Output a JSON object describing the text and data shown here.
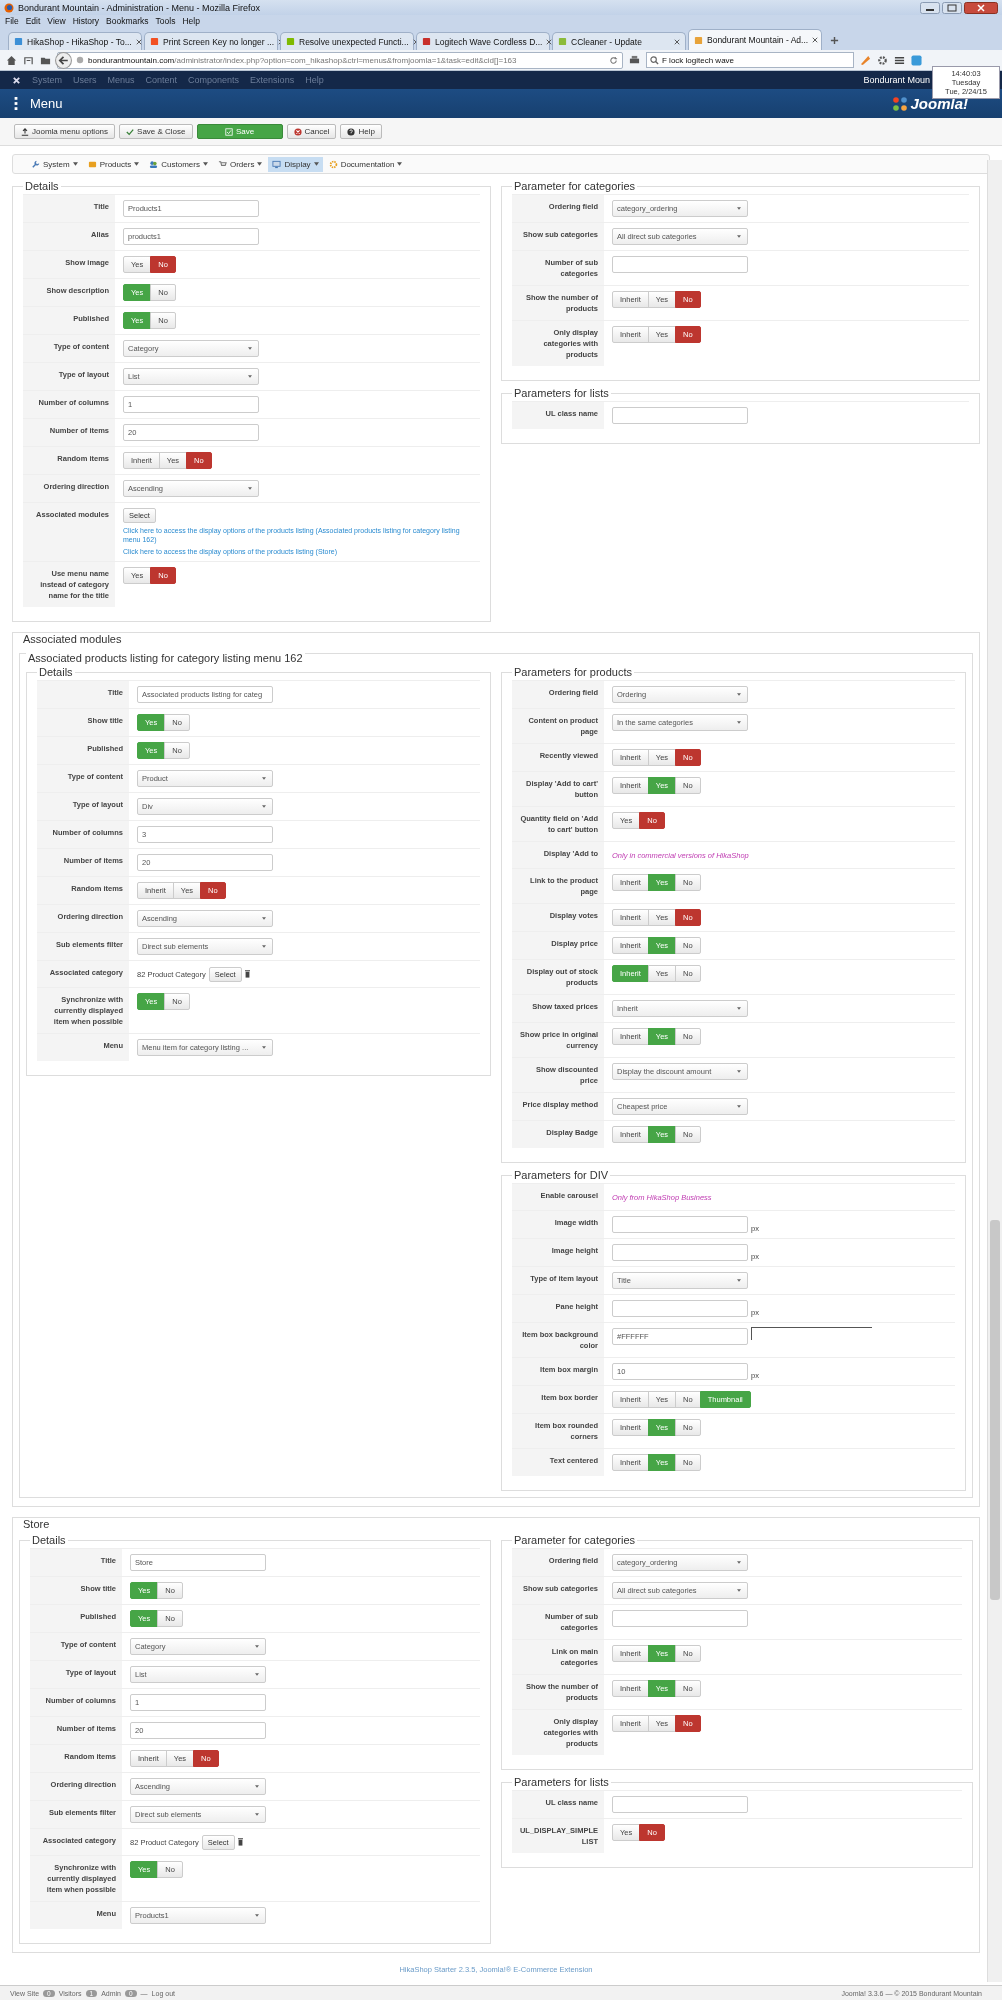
{
  "browser": {
    "title": "Bondurant Mountain - Administration - Menu - Mozilla Firefox",
    "menu": [
      "File",
      "Edit",
      "View",
      "History",
      "Bookmarks",
      "Tools",
      "Help"
    ],
    "tabs": [
      {
        "label": "HikaShop - HikaShop - To...",
        "selected": false
      },
      {
        "label": "Print Screen Key no longer ...",
        "selected": false
      },
      {
        "label": "Resolve unexpected Functi...",
        "selected": false
      },
      {
        "label": "Logitech Wave Cordless D...",
        "selected": false
      },
      {
        "label": "CCleaner - Update",
        "selected": false
      },
      {
        "label": "Bondurant Mountain - Ad...",
        "selected": true
      }
    ],
    "address": {
      "host": "bondurantmountain.com",
      "path": "/administrator/index.php?option=com_hikashop&ctrl=menus&fromjoomla=1&task=edit&cid[]=163"
    },
    "search": {
      "value": "F lock logitech wave"
    },
    "clock": [
      "14:40:03",
      "Tuesday",
      "Tue, 2/24/15"
    ]
  },
  "admin_menu": {
    "items": [
      "System",
      "Users",
      "Menus",
      "Content",
      "Components",
      "Extensions",
      "Help"
    ],
    "user": "Bondurant Moun"
  },
  "header": {
    "title": "Menu",
    "logo": "Joomla!"
  },
  "toolbar": [
    {
      "label": "Joomla menu options",
      "kind": "options"
    },
    {
      "label": "Save & Close",
      "kind": "check"
    },
    {
      "label": "Save",
      "kind": "save"
    },
    {
      "label": "Cancel",
      "kind": "cancel"
    },
    {
      "label": "Help",
      "kind": "help"
    }
  ],
  "submenu": [
    {
      "label": "System",
      "kind": "system",
      "selected": false
    },
    {
      "label": "Products",
      "kind": "products",
      "selected": false
    },
    {
      "label": "Customers",
      "kind": "customers",
      "selected": false
    },
    {
      "label": "Orders",
      "kind": "orders",
      "selected": false
    },
    {
      "label": "Display",
      "kind": "display",
      "selected": true
    },
    {
      "label": "Documentation",
      "kind": "documentation",
      "selected": false
    }
  ],
  "sections": [
    {
      "columns": [
        [
          {
            "legend": "Details",
            "rows": [
              {
                "label": "Title",
                "kind": "text",
                "value": "Products1"
              },
              {
                "label": "Alias",
                "kind": "text",
                "value": "products1"
              },
              {
                "label": "Show image",
                "kind": "toggle",
                "options": [
                  {
                    "label": "Yes",
                    "selected": false
                  },
                  {
                    "label": "No",
                    "selected": true,
                    "color": "#bd362f"
                  }
                ]
              },
              {
                "label": "Show description",
                "kind": "toggle",
                "options": [
                  {
                    "label": "Yes",
                    "selected": true,
                    "color": "#46a546"
                  },
                  {
                    "label": "No",
                    "selected": false
                  }
                ]
              },
              {
                "label": "Published",
                "kind": "toggle",
                "options": [
                  {
                    "label": "Yes",
                    "selected": true,
                    "color": "#46a546"
                  },
                  {
                    "label": "No",
                    "selected": false
                  }
                ]
              },
              {
                "label": "Type of content",
                "kind": "select",
                "value": "Category"
              },
              {
                "label": "Type of layout",
                "kind": "select",
                "value": "List"
              },
              {
                "label": "Number of columns",
                "kind": "text",
                "value": "1"
              },
              {
                "label": "Number of items",
                "kind": "text",
                "value": "20"
              },
              {
                "label": "Random items",
                "kind": "toggle",
                "options": [
                  {
                    "label": "Inherit",
                    "selected": false
                  },
                  {
                    "label": "Yes",
                    "selected": false
                  },
                  {
                    "label": "No",
                    "selected": true,
                    "color": "#bd362f"
                  }
                ]
              },
              {
                "label": "Ordering direction",
                "kind": "select",
                "value": "Ascending"
              },
              {
                "label": "Associated modules",
                "kind": "modules",
                "button": "Select",
                "links": [
                  "Click here to access the display options of the products listing (Associated products listing for category listing menu 162)",
                  "Click here to access the display options of the products listing (Store)"
                ]
              },
              {
                "label": "Use menu name instead of category name for the title",
                "kind": "toggle",
                "options": [
                  {
                    "label": "Yes",
                    "selected": false
                  },
                  {
                    "label": "No",
                    "selected": true,
                    "color": "#bd362f"
                  }
                ]
              }
            ]
          }
        ],
        [
          {
            "legend": "Parameter for categories",
            "rows": [
              {
                "label": "Ordering field",
                "kind": "select",
                "value": "category_ordering"
              },
              {
                "label": "Show sub categories",
                "kind": "select",
                "value": "All direct sub categories"
              },
              {
                "label": "Number of sub categories",
                "kind": "text"
              },
              {
                "label": "Show the number of products",
                "kind": "toggle",
                "options": [
                  {
                    "label": "Inherit",
                    "selected": false
                  },
                  {
                    "label": "Yes",
                    "selected": false
                  },
                  {
                    "label": "No",
                    "selected": true,
                    "color": "#bd362f"
                  }
                ]
              },
              {
                "label": "Only display categories with products",
                "kind": "toggle",
                "options": [
                  {
                    "label": "Inherit",
                    "selected": false
                  },
                  {
                    "label": "Yes",
                    "selected": false
                  },
                  {
                    "label": "No",
                    "selected": true,
                    "color": "#bd362f"
                  }
                ]
              }
            ]
          },
          {
            "legend": "Parameters for lists",
            "rows": [
              {
                "label": "UL class name",
                "kind": "text"
              }
            ]
          }
        ]
      ]
    },
    {
      "title": "Associated modules",
      "subtitle": "Associated products listing for category listing menu 162",
      "columns": [
        [
          {
            "legend": "Details",
            "rows": [
              {
                "label": "Title",
                "kind": "text",
                "value": "Associated products listing for categ"
              },
              {
                "label": "Show title",
                "kind": "toggle",
                "options": [
                  {
                    "label": "Yes",
                    "selected": true,
                    "color": "#46a546"
                  },
                  {
                    "label": "No",
                    "selected": false
                  }
                ]
              },
              {
                "label": "Published",
                "kind": "toggle",
                "options": [
                  {
                    "label": "Yes",
                    "selected": true,
                    "color": "#46a546"
                  },
                  {
                    "label": "No",
                    "selected": false
                  }
                ]
              },
              {
                "label": "Type of content",
                "kind": "select",
                "value": "Product"
              },
              {
                "label": "Type of layout",
                "kind": "select",
                "value": "Div"
              },
              {
                "label": "Number of columns",
                "kind": "text",
                "value": "3"
              },
              {
                "label": "Number of items",
                "kind": "text",
                "value": "20"
              },
              {
                "label": "Random items",
                "kind": "toggle",
                "options": [
                  {
                    "label": "Inherit",
                    "selected": false
                  },
                  {
                    "label": "Yes",
                    "selected": false
                  },
                  {
                    "label": "No",
                    "selected": true,
                    "color": "#bd362f"
                  }
                ]
              },
              {
                "label": "Ordering direction",
                "kind": "select",
                "value": "Ascending"
              },
              {
                "label": "Sub elements filter",
                "kind": "select",
                "value": "Direct sub elements"
              },
              {
                "label": "Associated category",
                "kind": "category",
                "value": "82 Product Category",
                "button": "Select"
              },
              {
                "label": "Synchronize with currently displayed item when possible",
                "kind": "toggle",
                "options": [
                  {
                    "label": "Yes",
                    "selected": true,
                    "color": "#46a546"
                  },
                  {
                    "label": "No",
                    "selected": false
                  }
                ]
              },
              {
                "label": "Menu",
                "kind": "select",
                "value": "Menu item for category listing ..."
              }
            ]
          }
        ],
        [
          {
            "legend": "Parameters for products",
            "rows": [
              {
                "label": "Ordering field",
                "kind": "select",
                "value": "Ordering"
              },
              {
                "label": "Content on product page",
                "kind": "select",
                "value": "In the same categories"
              },
              {
                "label": "Recently viewed",
                "kind": "toggle",
                "options": [
                  {
                    "label": "Inherit",
                    "selected": false
                  },
                  {
                    "label": "Yes",
                    "selected": false
                  },
                  {
                    "label": "No",
                    "selected": true,
                    "color": "#bd362f"
                  }
                ]
              },
              {
                "label": "Display 'Add to cart' button",
                "kind": "toggle",
                "options": [
                  {
                    "label": "Inherit",
                    "selected": false
                  },
                  {
                    "label": "Yes",
                    "selected": true,
                    "color": "#46a546"
                  },
                  {
                    "label": "No",
                    "selected": false
                  }
                ]
              },
              {
                "label": "Quantity field on 'Add to cart' button",
                "kind": "toggle",
                "options": [
                  {
                    "label": "Yes",
                    "selected": false
                  },
                  {
                    "label": "No",
                    "selected": true,
                    "color": "#bd362f"
                  }
                ]
              },
              {
                "label": "Display 'Add to",
                "kind": "note",
                "note": "Only in commercial versions of HikaShop"
              },
              {
                "label": "Link to the product page",
                "kind": "toggle",
                "options": [
                  {
                    "label": "Inherit",
                    "selected": false
                  },
                  {
                    "label": "Yes",
                    "selected": true,
                    "color": "#46a546"
                  },
                  {
                    "label": "No",
                    "selected": false
                  }
                ]
              },
              {
                "label": "Display votes",
                "kind": "toggle",
                "options": [
                  {
                    "label": "Inherit",
                    "selected": false
                  },
                  {
                    "label": "Yes",
                    "selected": false
                  },
                  {
                    "label": "No",
                    "selected": true,
                    "color": "#bd362f"
                  }
                ]
              },
              {
                "label": "Display price",
                "kind": "toggle",
                "options": [
                  {
                    "label": "Inherit",
                    "selected": false
                  },
                  {
                    "label": "Yes",
                    "selected": true,
                    "color": "#46a546"
                  },
                  {
                    "label": "No",
                    "selected": false
                  }
                ]
              },
              {
                "label": "Display out of stock products",
                "kind": "toggle",
                "options": [
                  {
                    "label": "Inherit",
                    "selected": true,
                    "color": "#46a546"
                  },
                  {
                    "label": "Yes",
                    "selected": false
                  },
                  {
                    "label": "No",
                    "selected": false
                  }
                ]
              },
              {
                "label": "Show taxed prices",
                "kind": "select",
                "value": "Inherit"
              },
              {
                "label": "Show price in original currency",
                "kind": "toggle",
                "options": [
                  {
                    "label": "Inherit",
                    "selected": false
                  },
                  {
                    "label": "Yes",
                    "selected": true,
                    "color": "#46a546"
                  },
                  {
                    "label": "No",
                    "selected": false
                  }
                ]
              },
              {
                "label": "Show discounted price",
                "kind": "select",
                "value": "Display the discount amount"
              },
              {
                "label": "Price display method",
                "kind": "select",
                "value": "Cheapest price"
              },
              {
                "label": "Display Badge",
                "kind": "toggle",
                "options": [
                  {
                    "label": "Inherit",
                    "selected": false
                  },
                  {
                    "label": "Yes",
                    "selected": true,
                    "color": "#46a546"
                  },
                  {
                    "label": "No",
                    "selected": false
                  }
                ]
              }
            ]
          },
          {
            "legend": "Parameters for DIV",
            "rows": [
              {
                "label": "Enable carousel",
                "kind": "note",
                "note": "Only from HikaShop Business"
              },
              {
                "label": "Image width",
                "kind": "unit",
                "unit": "px"
              },
              {
                "label": "Image height",
                "kind": "unit",
                "unit": "px"
              },
              {
                "label": "Type of item layout",
                "kind": "select",
                "value": "Title"
              },
              {
                "label": "Pane height",
                "kind": "unit",
                "unit": "px"
              },
              {
                "label": "Item box background color",
                "kind": "color",
                "value": "#FFFFFF"
              },
              {
                "label": "Item box margin",
                "kind": "unit",
                "value": "10",
                "unit": "px"
              },
              {
                "label": "Item box border",
                "kind": "toggle",
                "options": [
                  {
                    "label": "Inherit",
                    "selected": false
                  },
                  {
                    "label": "Yes",
                    "selected": false
                  },
                  {
                    "label": "No",
                    "selected": false
                  },
                  {
                    "label": "Thumbnail",
                    "selected": true,
                    "color": "#46a546"
                  }
                ]
              },
              {
                "label": "Item box rounded corners",
                "kind": "toggle",
                "options": [
                  {
                    "label": "Inherit",
                    "selected": false
                  },
                  {
                    "label": "Yes",
                    "selected": true,
                    "color": "#46a546"
                  },
                  {
                    "label": "No",
                    "selected": false
                  }
                ]
              },
              {
                "label": "Text centered",
                "kind": "toggle",
                "options": [
                  {
                    "label": "Inherit",
                    "selected": false
                  },
                  {
                    "label": "Yes",
                    "selected": true,
                    "color": "#46a546"
                  },
                  {
                    "label": "No",
                    "selected": false
                  }
                ]
              }
            ]
          }
        ]
      ]
    },
    {
      "title": "Store",
      "columns": [
        [
          {
            "legend": "Details",
            "rows": [
              {
                "label": "Title",
                "kind": "text",
                "value": "Store"
              },
              {
                "label": "Show title",
                "kind": "toggle",
                "options": [
                  {
                    "label": "Yes",
                    "selected": true,
                    "color": "#46a546"
                  },
                  {
                    "label": "No",
                    "selected": false
                  }
                ]
              },
              {
                "label": "Published",
                "kind": "toggle",
                "options": [
                  {
                    "label": "Yes",
                    "selected": true,
                    "color": "#46a546"
                  },
                  {
                    "label": "No",
                    "selected": false
                  }
                ]
              },
              {
                "label": "Type of content",
                "kind": "select",
                "value": "Category"
              },
              {
                "label": "Type of layout",
                "kind": "select",
                "value": "List"
              },
              {
                "label": "Number of columns",
                "kind": "text",
                "value": "1"
              },
              {
                "label": "Number of items",
                "kind": "text",
                "value": "20"
              },
              {
                "label": "Random items",
                "kind": "toggle",
                "options": [
                  {
                    "label": "Inherit",
                    "selected": false
                  },
                  {
                    "label": "Yes",
                    "selected": false
                  },
                  {
                    "label": "No",
                    "selected": true,
                    "color": "#bd362f"
                  }
                ]
              },
              {
                "label": "Ordering direction",
                "kind": "select",
                "value": "Ascending"
              },
              {
                "label": "Sub elements filter",
                "kind": "select",
                "value": "Direct sub elements"
              },
              {
                "label": "Associated category",
                "kind": "category",
                "value": "82 Product Category",
                "button": "Select"
              },
              {
                "label": "Synchronize with currently displayed item when possible",
                "kind": "toggle",
                "options": [
                  {
                    "label": "Yes",
                    "selected": true,
                    "color": "#46a546"
                  },
                  {
                    "label": "No",
                    "selected": false
                  }
                ]
              },
              {
                "label": "Menu",
                "kind": "select",
                "value": "Products1"
              }
            ]
          }
        ],
        [
          {
            "legend": "Parameter for categories",
            "rows": [
              {
                "label": "Ordering field",
                "kind": "select",
                "value": "category_ordering"
              },
              {
                "label": "Show sub categories",
                "kind": "select",
                "value": "All direct sub categories"
              },
              {
                "label": "Number of sub categories",
                "kind": "text"
              },
              {
                "label": "Link on main categories",
                "kind": "toggle",
                "options": [
                  {
                    "label": "Inherit",
                    "selected": false
                  },
                  {
                    "label": "Yes",
                    "selected": true,
                    "color": "#46a546"
                  },
                  {
                    "label": "No",
                    "selected": false
                  }
                ]
              },
              {
                "label": "Show the number of products",
                "kind": "toggle",
                "options": [
                  {
                    "label": "Inherit",
                    "selected": false
                  },
                  {
                    "label": "Yes",
                    "selected": true,
                    "color": "#46a546"
                  },
                  {
                    "label": "No",
                    "selected": false
                  }
                ]
              },
              {
                "label": "Only display categories with products",
                "kind": "toggle",
                "options": [
                  {
                    "label": "Inherit",
                    "selected": false
                  },
                  {
                    "label": "Yes",
                    "selected": false
                  },
                  {
                    "label": "No",
                    "selected": true,
                    "color": "#bd362f"
                  }
                ]
              }
            ]
          },
          {
            "legend": "Parameters for lists",
            "rows": [
              {
                "label": "UL class name",
                "kind": "text"
              },
              {
                "label": "UL_DISPLAY_SIMPLELIST",
                "kind": "toggle",
                "options": [
                  {
                    "label": "Yes",
                    "selected": false
                  },
                  {
                    "label": "No",
                    "selected": true,
                    "color": "#bd362f"
                  }
                ]
              }
            ]
          }
        ]
      ]
    }
  ],
  "footer": {
    "credit": "HikaShop Starter 2.3.5, Joomla!® E-Commerce Extension",
    "status": [
      {
        "kind": "link",
        "label": "View Site"
      },
      {
        "kind": "badge",
        "label": "0"
      },
      {
        "kind": "text",
        "label": "Visitors"
      },
      {
        "kind": "badge",
        "label": "1"
      },
      {
        "kind": "text",
        "label": "Admin"
      },
      {
        "kind": "badge",
        "label": "0"
      },
      {
        "kind": "text",
        "label": "—"
      },
      {
        "kind": "link",
        "label": "Log out"
      }
    ],
    "version": "Joomla! 3.3.6 — © 2015 Bondurant Mountain"
  }
}
